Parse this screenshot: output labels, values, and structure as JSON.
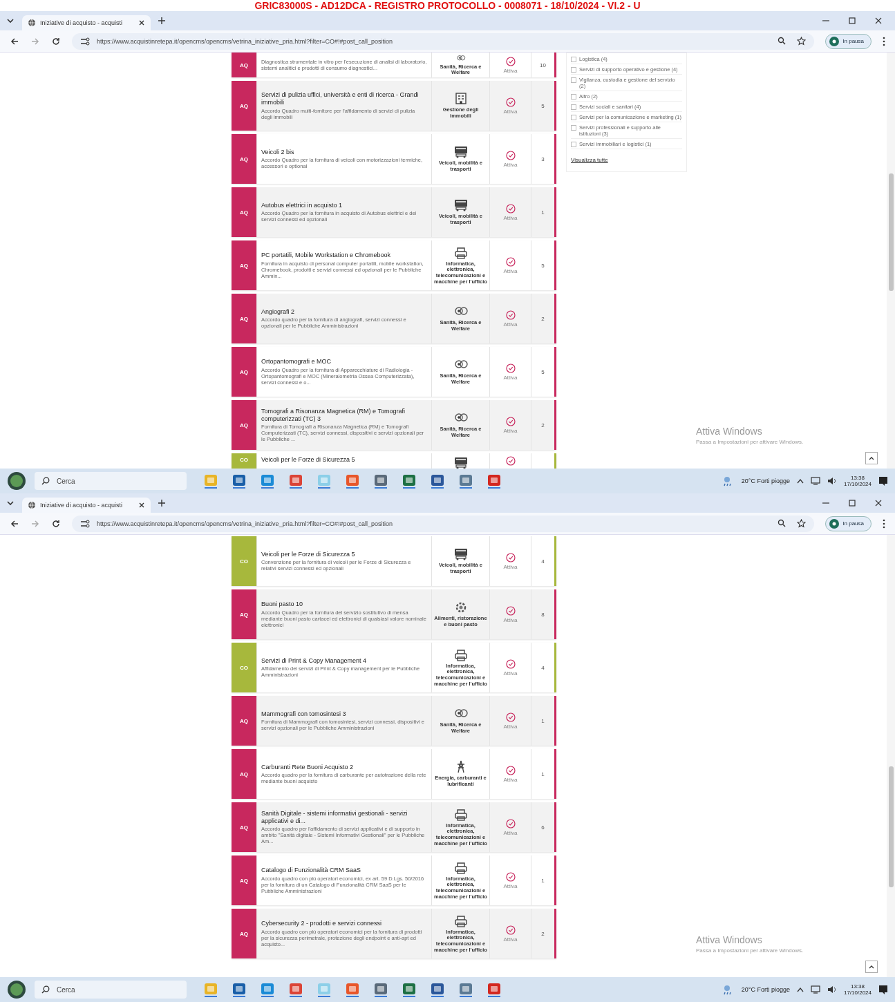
{
  "document_header": "GRIC83000S - AD12DCA - REGISTRO PROTOCOLLO - 0008071 - 18/10/2024 - VI.2 - U",
  "windows": [
    {
      "tab_title": "Iniziative di acquisto - acquisti",
      "url": "https://www.acquistinretepa.it/opencms/opencms/vetrina_iniziative_pria.html?filter=CO#!#post_call_position",
      "profile_label": "In pausa",
      "rows": [
        {
          "badge": "AQ",
          "color": "#c8285e",
          "description": "Diagnostica strumentale in vitro per l'esecuzione di analisi di laboratorio, sistemi analitici e prodotti di consumo diagnostici...",
          "category": "Sanità, Ricerca e Welfare",
          "kind": "health",
          "status": "Attiva",
          "count": "10"
        },
        {
          "badge": "AQ",
          "color": "#c8285e",
          "title": "Servizi di pulizia uffici, università e enti di ricerca - Grandi immobili",
          "description": "Accordo Quadro multi-fornitore per l'affidamento di servizi di pulizia degli immobili",
          "category": "Gestione degli immobili",
          "kind": "building",
          "status": "Attiva",
          "count": "5"
        },
        {
          "badge": "AQ",
          "color": "#c8285e",
          "title": "Veicoli 2 bis",
          "description": "Accordo Quadro per la fornitura di veicoli con motorizzazioni termiche, accessori e optional",
          "category": "Veicoli, mobilità e trasporti",
          "kind": "vehicle",
          "status": "Attiva",
          "count": "3"
        },
        {
          "badge": "AQ",
          "color": "#c8285e",
          "title": "Autobus elettrici in acquisto 1",
          "description": "Accordo Quadro per la fornitura in acquisto di Autobus elettrici e dei servizi connessi ed opzionali",
          "category": "Veicoli, mobilità e trasporti",
          "kind": "vehicle",
          "status": "Attiva",
          "count": "1"
        },
        {
          "badge": "AQ",
          "color": "#c8285e",
          "title": "PC portatili, Mobile Workstation e Chromebook",
          "description": "Fornitura in acquisto di personal computer portatili, mobile workstation, Chromebook, prodotti e servizi connessi ed opzionali per le Pubbliche Ammin...",
          "category": "Informatica, elettronica, telecomunicazioni e macchine per l'ufficio",
          "kind": "computer",
          "status": "Attiva",
          "count": "5"
        },
        {
          "badge": "AQ",
          "color": "#c8285e",
          "title": "Angiografi 2",
          "description": "Accordo quadro per la fornitura di angiografi, servizi connessi e opzionali per le Pubbliche Amministrazioni",
          "category": "Sanità, Ricerca e Welfare",
          "kind": "health",
          "status": "Attiva",
          "count": "2"
        },
        {
          "badge": "AQ",
          "color": "#c8285e",
          "title": "Ortopantomografi e MOC",
          "description": "Accordo Quadro per la fornitura di Apparecchiature di Radiologia - Ortopantomografi e MOC (Mineralometria Ossea Computerizzata), servizi connessi e o...",
          "category": "Sanità, Ricerca e Welfare",
          "kind": "health",
          "status": "Attiva",
          "count": "5"
        },
        {
          "badge": "AQ",
          "color": "#c8285e",
          "title": "Tomografi a Risonanza Magnetica (RM) e Tomografi computerizzati (TC) 3",
          "description": "Fornitura di Tomografi a Risonanza Magnetica (RM) e Tomografi Computerizzati (TC), servizi connessi, dispositivi e servizi opzionali per le Pubbliche ...",
          "category": "Sanità, Ricerca e Welfare",
          "kind": "health",
          "status": "Attiva",
          "count": "2"
        },
        {
          "badge": "CO",
          "color": "#a7b83c",
          "title": "Veicoli per le Forze di Sicurezza 5",
          "kind": "vehicle"
        }
      ],
      "sidebar": {
        "items": [
          {
            "label": "Logistica (4)",
            "checked": false
          },
          {
            "label": "Servizi di supporto operativo e gestione (4)",
            "checked": false
          },
          {
            "label": "Vigilanza, custodia e gestione del servizio (2)",
            "checked": false
          },
          {
            "label": "Altro (2)",
            "checked": false
          },
          {
            "label": "Servizi sociali e sanitari (4)",
            "checked": false
          },
          {
            "label": "Servizi per la comunicazione e marketing (1)",
            "checked": false
          },
          {
            "label": "Servizi professionali e supporto alle istituzioni (3)",
            "checked": false
          },
          {
            "label": "Servizi immobiliari e logistici (1)",
            "checked": false
          }
        ],
        "link": "Visualizza tutte"
      },
      "activation_notice": {
        "title": "Attiva Windows",
        "subtitle": "Passa a Impostazioni per attivare Windows."
      },
      "taskbar": {
        "search_placeholder": "Cerca",
        "weather": "20°C  Forti piogge",
        "time": "13:38",
        "date": "17/10/2024"
      }
    },
    {
      "tab_title": "Iniziative di acquisto - acquisti",
      "url": "https://www.acquistinretepa.it/opencms/opencms/vetrina_iniziative_pria.html?filter=CO#!#post_call_position",
      "profile_label": "In pausa",
      "rows": [
        {
          "badge": "CO",
          "color": "#a7b83c",
          "title": "Veicoli per le Forze di Sicurezza 5",
          "description": "Convenzione per la fornitura di veicoli per le Forze di Sicurezza e relativi servizi connessi ed opzionali",
          "category": "Veicoli, mobilità e trasporti",
          "kind": "vehicle",
          "status": "Attiva",
          "count": "4"
        },
        {
          "badge": "AQ",
          "color": "#c8285e",
          "title": "Buoni pasto 10",
          "description": "Accordo Quadro per la fornitura del servizio sostitutivo di mensa mediante buoni pasto cartacei ed elettronici di qualsiasi valore nominale elettronici",
          "category": "Alimenti, ristorazione e buoni pasto",
          "kind": "food",
          "status": "Attiva",
          "count": "8"
        },
        {
          "badge": "CO",
          "color": "#a7b83c",
          "title": "Servizi di Print & Copy Management 4",
          "description": "Affidamento dei servizi di Print & Copy management per le Pubbliche Amministrazioni",
          "category": "Informatica, elettronica, telecomunicazioni e macchine per l'ufficio",
          "kind": "computer",
          "status": "Attiva",
          "count": "4"
        },
        {
          "badge": "AQ",
          "color": "#c8285e",
          "title": "Mammografi con tomosintesi 3",
          "description": "Fornitura di Mammografi con tomosintesi, servizi connessi, dispositivi e servizi opzionali per le Pubbliche Amministrazioni",
          "category": "Sanità, Ricerca e Welfare",
          "kind": "health",
          "status": "Attiva",
          "count": "1"
        },
        {
          "badge": "AQ",
          "color": "#c8285e",
          "title": "Carburanti Rete Buoni Acquisto 2",
          "description": "Accordo quadro per la fornitura di carburante per autotrazione della rete mediante buoni acquisto",
          "category": "Energia, carburanti e lubrificanti",
          "kind": "fuel",
          "status": "Attiva",
          "count": "1"
        },
        {
          "badge": "AQ",
          "color": "#c8285e",
          "title": "Sanità Digitale - sistemi informativi gestionali - servizi applicativi e di...",
          "description": "Accordo quadro per l'affidamento di servizi applicativi e di supporto in ambito \"Sanità digitale - Sistemi Informativi Gestionali\" per le Pubbliche Am...",
          "category": "Informatica, elettronica, telecomunicazioni e macchine per l'ufficio",
          "kind": "computer",
          "status": "Attiva",
          "count": "6"
        },
        {
          "badge": "AQ",
          "color": "#c8285e",
          "title": "Catalogo di Funzionalità CRM SaaS",
          "description": "Accordo quadro con più operatori economici, ex art. 59 D.Lgs. 50/2016 per la fornitura di un Catalogo di Funzionalità CRM SaaS per le Pubbliche Amministrazioni",
          "category": "Informatica, elettronica, telecomunicazioni e macchine per l'ufficio",
          "kind": "computer",
          "status": "Attiva",
          "count": "1"
        },
        {
          "badge": "AQ",
          "color": "#c8285e",
          "title": "Cybersecurity 2 - prodotti e servizi connessi",
          "description": "Accordo quadro con più operatori economici per la fornitura di prodotti per la sicurezza perimetrale, protezione degli endpoint e anti-apt ed acquisto...",
          "category": "Informatica, elettronica, telecomunicazioni e macchine per l'ufficio",
          "kind": "computer",
          "status": "Attiva",
          "count": "2"
        }
      ],
      "activation_notice": {
        "title": "Attiva Windows",
        "subtitle": "Passa a Impostazioni per attivare Windows."
      },
      "taskbar": {
        "search_placeholder": "Cerca",
        "weather": "20°C  Forti piogge",
        "time": "13:38",
        "date": "17/10/2024"
      }
    }
  ]
}
